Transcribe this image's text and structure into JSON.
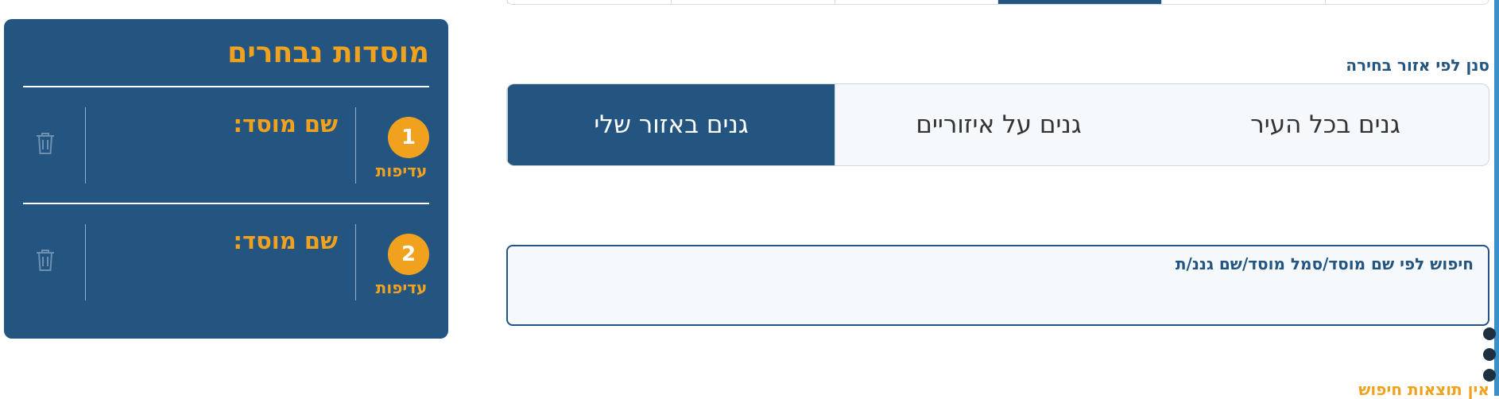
{
  "top_tabs": {
    "count": 6,
    "active_index": 3
  },
  "region_label": "סנן לפי אזור בחירה",
  "region_tabs": [
    {
      "label": "גנים באזור שלי",
      "active": true
    },
    {
      "label": "גנים על איזוריים",
      "active": false
    },
    {
      "label": "גנים בכל העיר",
      "active": false
    }
  ],
  "search": {
    "placeholder": "חיפוש לפי שם מוסד/סמל מוסד/שם גננ/ת",
    "value": ""
  },
  "no_results": "אין תוצאות חיפוש",
  "panel": {
    "title": "מוסדות נבחרים",
    "preferences": [
      {
        "number": "1",
        "pref_label": "עדיפות",
        "institution_label": "שם מוסד:"
      },
      {
        "number": "2",
        "pref_label": "עדיפות",
        "institution_label": "שם מוסד:"
      }
    ]
  },
  "colors": {
    "primary": "#245580",
    "accent": "#f0a21e",
    "light_bg": "#f5f9fc"
  },
  "icons": {
    "delete": "trash-icon",
    "dots": "dot-indicator"
  }
}
